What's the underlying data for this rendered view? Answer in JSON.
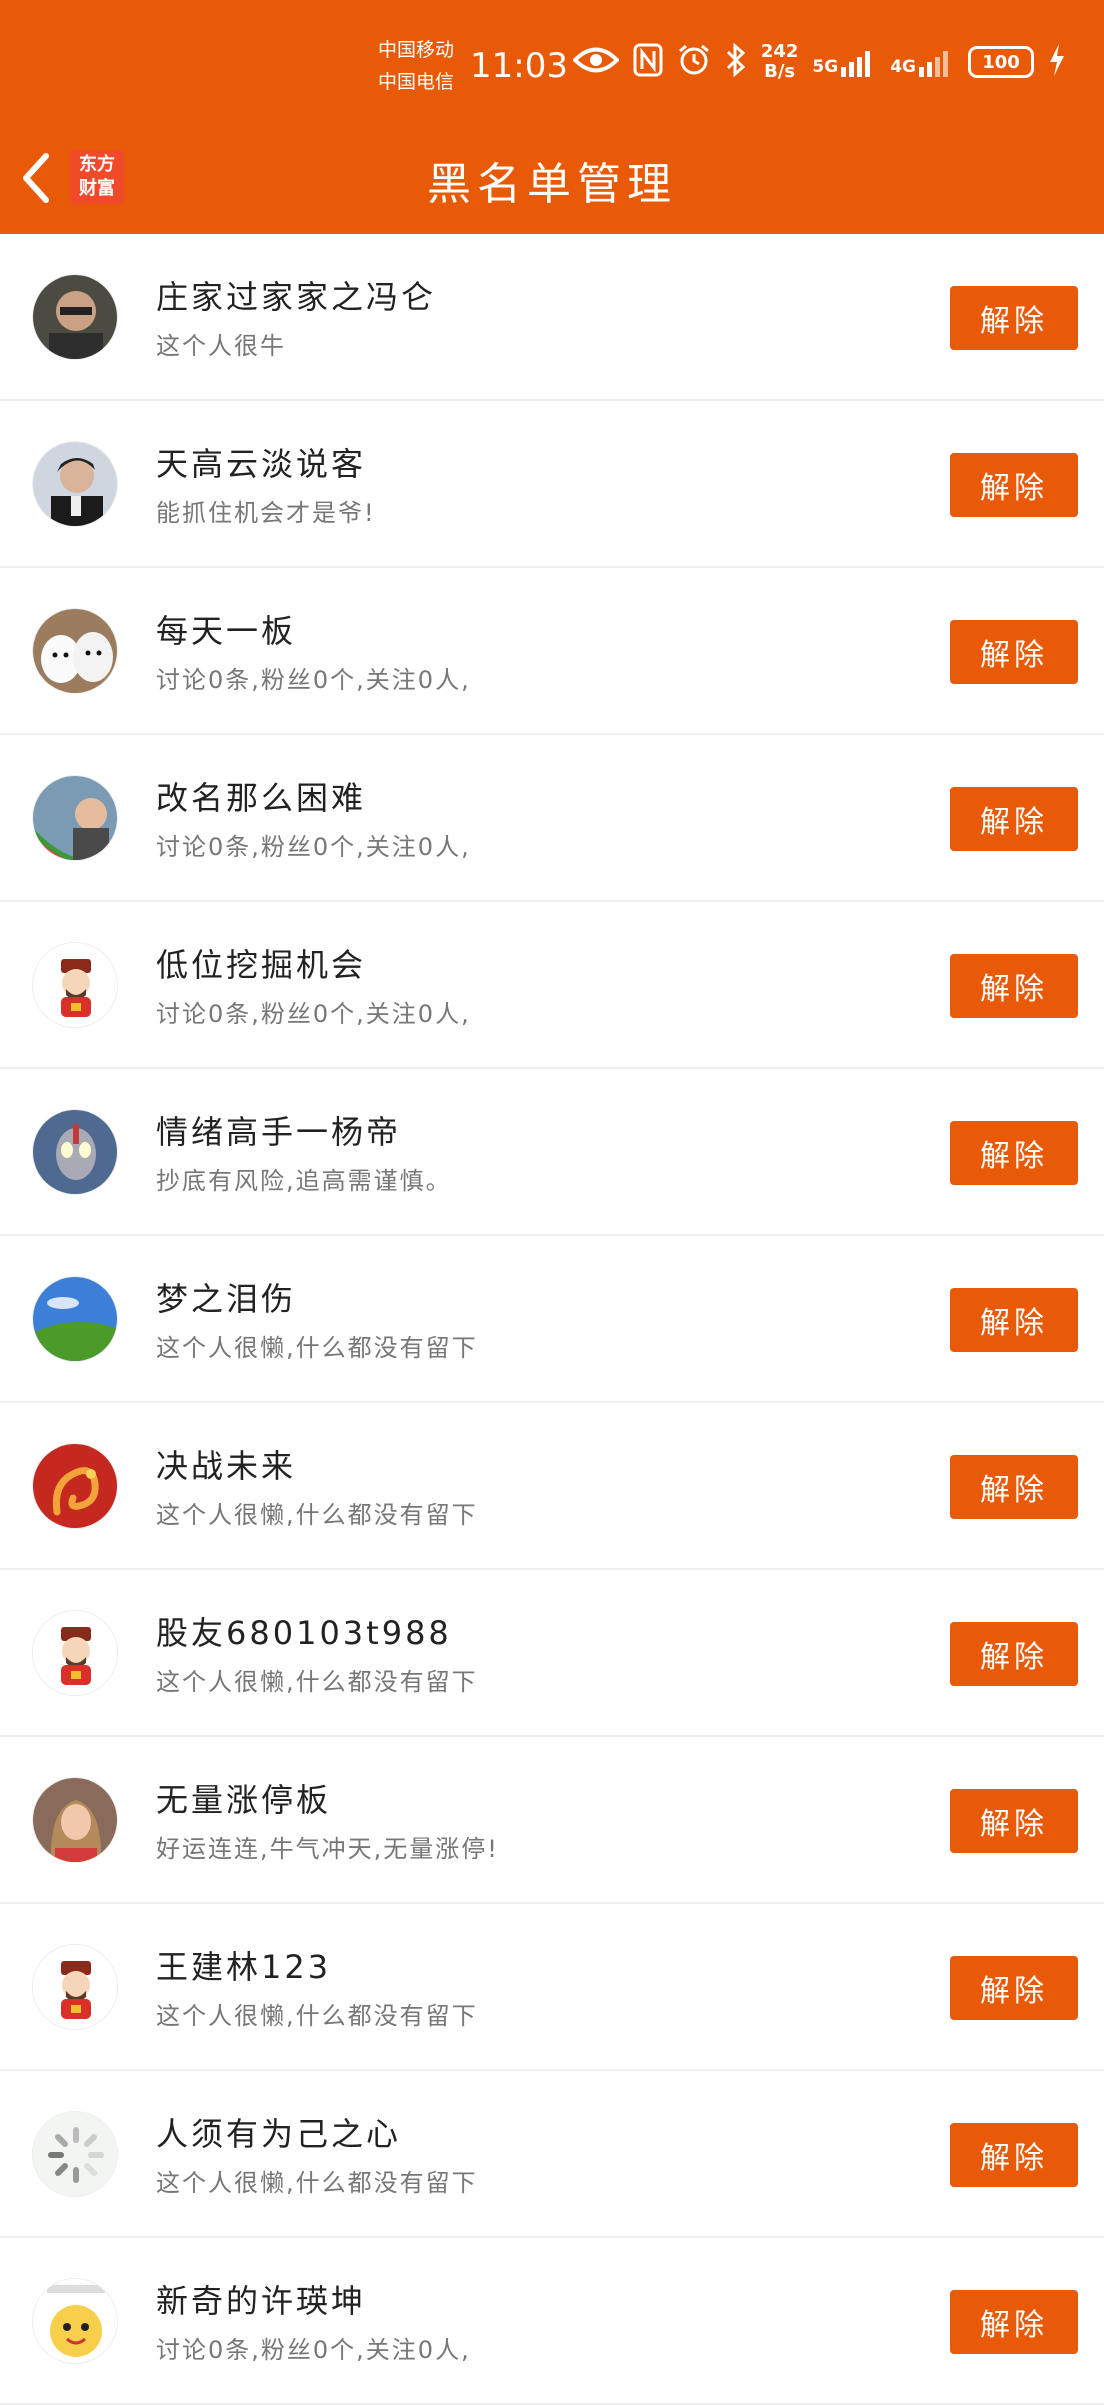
{
  "status_bar": {
    "carrier_1": "中国移动",
    "carrier_2": "中国电信",
    "time": "11:03",
    "net_speed_value": "242",
    "net_speed_unit": "B/s",
    "signal_1": "5G",
    "signal_2": "4G",
    "battery": "100"
  },
  "header": {
    "brand_line1": "东方",
    "brand_line2": "财富",
    "title": "黑名单管理"
  },
  "list": {
    "items": [
      {
        "name": "庄家过家家之冯仑",
        "desc": "这个人很牛",
        "button": "解除",
        "avatar": "photo-man-glasses"
      },
      {
        "name": "天高云淡说客",
        "desc": "能抓住机会才是爷!",
        "button": "解除",
        "avatar": "photo-man-suit"
      },
      {
        "name": "每天一板",
        "desc": "讨论0条,粉丝0个,关注0人,",
        "button": "解除",
        "avatar": "photo-white-dogs"
      },
      {
        "name": "改名那么困难",
        "desc": "讨论0条,粉丝0个,关注0人,",
        "button": "解除",
        "avatar": "photo-child-watermelon"
      },
      {
        "name": "低位挖掘机会",
        "desc": "讨论0条,粉丝0个,关注0人,",
        "button": "解除",
        "avatar": "default-fortune-god"
      },
      {
        "name": "情绪高手一杨帝",
        "desc": "抄底有风险,追高需谨慎。",
        "button": "解除",
        "avatar": "photo-ultraman"
      },
      {
        "name": "梦之泪伤",
        "desc": "这个人很懒,什么都没有留下",
        "button": "解除",
        "avatar": "photo-green-hill"
      },
      {
        "name": "决战未来",
        "desc": "这个人很懒,什么都没有留下",
        "button": "解除",
        "avatar": "photo-red-dragon"
      },
      {
        "name": "股友680103t988",
        "desc": "这个人很懒,什么都没有留下",
        "button": "解除",
        "avatar": "default-fortune-god"
      },
      {
        "name": "无量涨停板",
        "desc": "好运连连,牛气冲天,无量涨停!",
        "button": "解除",
        "avatar": "photo-woman"
      },
      {
        "name": "王建林123",
        "desc": "这个人很懒,什么都没有留下",
        "button": "解除",
        "avatar": "default-fortune-god"
      },
      {
        "name": "人须有为己之心",
        "desc": "这个人很懒,什么都没有留下",
        "button": "解除",
        "avatar": "loading-spinner"
      },
      {
        "name": "新奇的许瑛坤",
        "desc": "讨论0条,粉丝0个,关注0人,",
        "button": "解除",
        "avatar": "cartoon-face"
      }
    ]
  },
  "colors": {
    "accent": "#e85a07",
    "brand_red": "#f04a2a",
    "divider": "#efefef",
    "name_text": "#222222",
    "desc_text": "#777777"
  }
}
